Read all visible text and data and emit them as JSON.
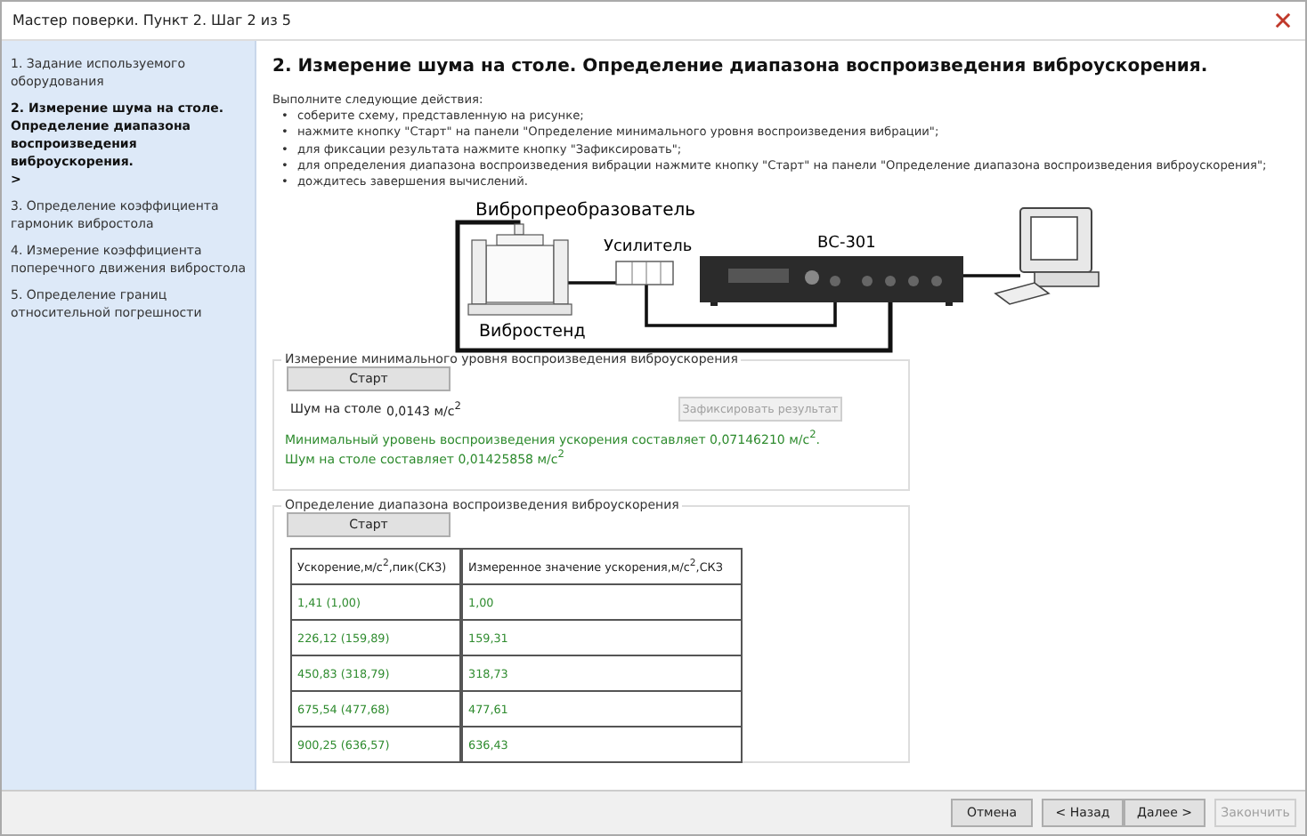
{
  "window": {
    "title": "Мастер поверки. Пункт 2. Шаг 2 из 5"
  },
  "sidebar": {
    "current_marker": ">",
    "steps": [
      {
        "label": "1.  Задание используемого оборудования",
        "selected": false
      },
      {
        "label": "2.  Измерение шума на столе. Определение диапазона воспроизведения виброускорения.",
        "selected": true
      },
      {
        "label": "3.  Определение коэффициента гармоник вибростола",
        "selected": false
      },
      {
        "label": "4.  Измерение коэффициента поперечного движения вибростола",
        "selected": false
      },
      {
        "label": "5.  Определение границ относительной погрешности",
        "selected": false
      }
    ]
  },
  "heading": "2.  Измерение шума на столе. Определение диапазона воспроизведения виброускорения.",
  "instructions": {
    "intro": "Выполните следующие действия:",
    "bullet": "•",
    "items": [
      "соберите схему, представленную на рисунке;",
      "нажмите кнопку \"Старт\" на панели \"Определение минимального уровня воспроизведения вибрации\";",
      "для фиксации результата нажмите кнопку \"Зафиксировать\";",
      "для определения диапазона воспроизведения вибрации нажмите кнопку \"Старт\" на панели \"Определение диапазона воспроизведения виброускорения\";",
      "дождитесь завершения вычислений."
    ]
  },
  "diagram": {
    "sensor_label": "Вибропреобразователь",
    "amplifier_label": "Усилитель",
    "device_label": "ВС-301",
    "stand_label": "Вибростенд"
  },
  "min_level_panel": {
    "legend": "Измерение минимального уровня воспроизведения виброускорения",
    "start_button": "Старт",
    "noise_label": "Шум на столе",
    "noise_value": "0,0143 м/с$^{2}$",
    "record_button": {
      "label": "Зафиксировать результат",
      "disabled": true
    },
    "results": [
      "Минимальный уровень воспроизведения ускорения составляет 0,07146210 м/с$^{2}$.",
      "Шум на столе составляет 0,01425858 м/с$^{2}$"
    ]
  },
  "range_panel": {
    "legend": "Определение диапазона воспроизведения виброускорения",
    "start_button": "Старт",
    "table": {
      "columns": [
        "Ускорение,м/с$^{2}$,пик(СКЗ)",
        "Измеренное значение ускорения,м/с$^{2}$,СКЗ"
      ],
      "rows": [
        [
          "1,41 (1,00)",
          "1,00"
        ],
        [
          "226,12 (159,89)",
          "159,31"
        ],
        [
          "450,83 (318,79)",
          "318,73"
        ],
        [
          "675,54 (477,68)",
          "477,61"
        ],
        [
          "900,25 (636,57)",
          "636,43"
        ]
      ]
    }
  },
  "buttons": [
    {
      "label": "Отмена",
      "disabled": false
    },
    {
      "label": "< Назад",
      "disabled": false
    },
    {
      "label": "Далее >",
      "disabled": false
    },
    {
      "label": "Закончить",
      "disabled": true
    }
  ]
}
